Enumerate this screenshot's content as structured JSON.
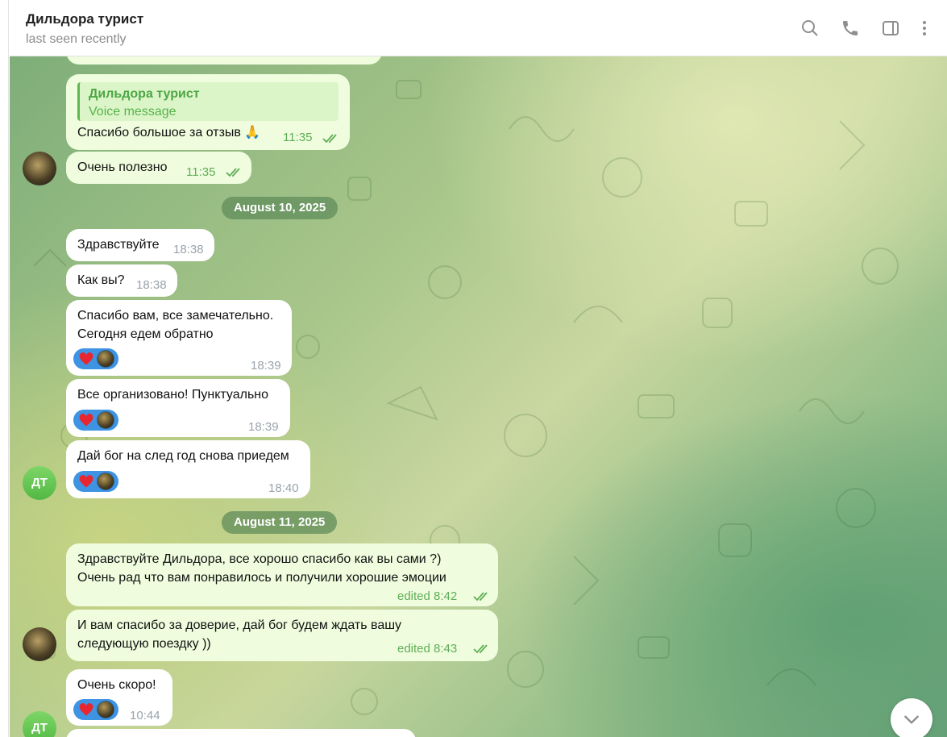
{
  "header": {
    "title": "Дильдора турист",
    "status": "last seen recently",
    "icons": [
      "search-icon",
      "phone-icon",
      "sidebar-toggle-icon",
      "more-vertical-icon"
    ]
  },
  "chat": {
    "avatar_initials": "ДТ",
    "dates": [
      "August 10, 2025",
      "August 11, 2025"
    ],
    "messages": [
      {
        "reply_name": "Дильдора турист",
        "reply_text": "Voice message",
        "text": "Спасибо большое за отзыв 🙏",
        "time": "11:35"
      },
      {
        "text": "Очень полезно",
        "time": "11:35"
      },
      {
        "text": "Здравствуйте",
        "time": "18:38"
      },
      {
        "text": "Как вы?",
        "time": "18:38"
      },
      {
        "text": "Спасибо вам, все замечательно.",
        "text2": "Сегодня едем обратно",
        "time": "18:39"
      },
      {
        "text": "Все организовано! Пунктуально",
        "time": "18:39"
      },
      {
        "text": "Дай бог на след год снова приедем",
        "time": "18:40"
      },
      {
        "text": "Здравствуйте Дильдора, все хорошо спасибо как вы сами ?)",
        "text2": "Очень рад что вам понравилось и получили хорошие эмоции",
        "time": "edited 8:42"
      },
      {
        "text": "И вам спасибо за доверие, дай бог будем ждать вашу",
        "text2": "следующую поездку ))",
        "time": "edited 8:43"
      },
      {
        "text": "Очень скоро!",
        "time": "10:44"
      }
    ],
    "reaction_emoji": "heart-icon",
    "colors": {
      "incoming": "#ffffff",
      "outgoing": "#effdde",
      "accent_green": "#4da746",
      "reaction_blue": "#3e93e3",
      "date_pill": "#608c5a"
    }
  }
}
